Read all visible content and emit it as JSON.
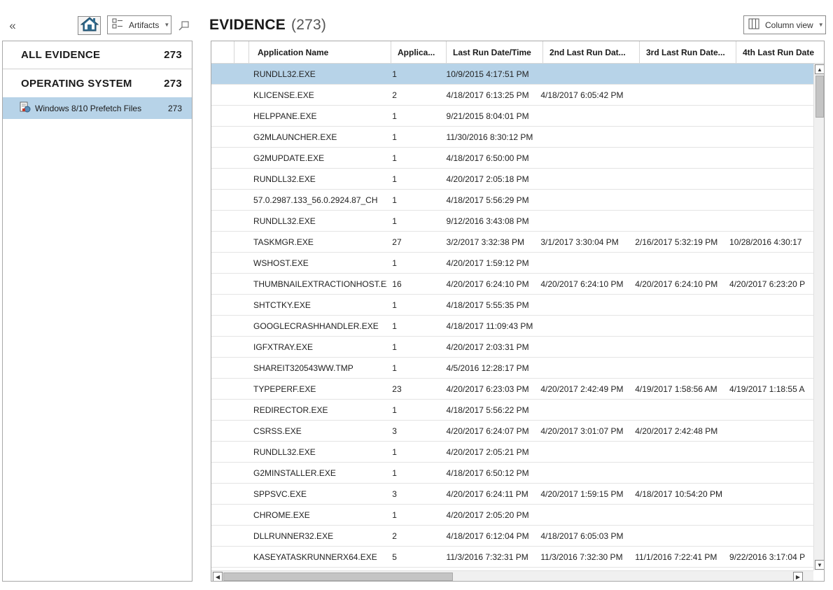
{
  "toolbar": {
    "collapse_glyph": "«",
    "home_icon": "home-icon",
    "artifacts_label": "Artifacts",
    "pin_icon": "pin-icon"
  },
  "categories": [
    {
      "label": "ALL EVIDENCE",
      "count": "273"
    },
    {
      "label": "OPERATING SYSTEM",
      "count": "273"
    }
  ],
  "subcategory": {
    "label": "Windows 8/10 Prefetch Files",
    "count": "273",
    "icon": "prefetch-file-icon"
  },
  "header": {
    "title": "EVIDENCE",
    "count": "(273)",
    "column_view_label": "Column view"
  },
  "colors": {
    "selection": "#b7d3e8",
    "border": "#a8a8a8"
  },
  "grid": {
    "columns": [
      "",
      "",
      "Application Name",
      "Applica...",
      "Last Run Date/Time",
      "2nd Last Run Dat...",
      "3rd Last Run Date...",
      "4th Last Run Date"
    ],
    "rows": [
      [
        "RUNDLL32.EXE",
        "1",
        "10/9/2015 4:17:51 PM",
        "",
        "",
        ""
      ],
      [
        "KLICENSE.EXE",
        "2",
        "4/18/2017 6:13:25 PM",
        "4/18/2017 6:05:42 PM",
        "",
        ""
      ],
      [
        "HELPPANE.EXE",
        "1",
        "9/21/2015 8:04:01 PM",
        "",
        "",
        ""
      ],
      [
        "G2MLAUNCHER.EXE",
        "1",
        "11/30/2016 8:30:12 PM",
        "",
        "",
        ""
      ],
      [
        "G2MUPDATE.EXE",
        "1",
        "4/18/2017 6:50:00 PM",
        "",
        "",
        ""
      ],
      [
        "RUNDLL32.EXE",
        "1",
        "4/20/2017 2:05:18 PM",
        "",
        "",
        ""
      ],
      [
        "57.0.2987.133_56.0.2924.87_CH",
        "1",
        "4/18/2017 5:56:29 PM",
        "",
        "",
        ""
      ],
      [
        "RUNDLL32.EXE",
        "1",
        "9/12/2016 3:43:08 PM",
        "",
        "",
        ""
      ],
      [
        "TASKMGR.EXE",
        "27",
        "3/2/2017 3:32:38 PM",
        "3/1/2017 3:30:04 PM",
        "2/16/2017 5:32:19 PM",
        "10/28/2016 4:30:17"
      ],
      [
        "WSHOST.EXE",
        "1",
        "4/20/2017 1:59:12 PM",
        "",
        "",
        ""
      ],
      [
        "THUMBNAILEXTRACTIONHOST.EXE",
        "16",
        "4/20/2017 6:24:10 PM",
        "4/20/2017 6:24:10 PM",
        "4/20/2017 6:24:10 PM",
        "4/20/2017 6:23:20 P"
      ],
      [
        "SHTCTKY.EXE",
        "1",
        "4/18/2017 5:55:35 PM",
        "",
        "",
        ""
      ],
      [
        "GOOGLECRASHHANDLER.EXE",
        "1",
        "4/18/2017 11:09:43 PM",
        "",
        "",
        ""
      ],
      [
        "IGFXTRAY.EXE",
        "1",
        "4/20/2017 2:03:31 PM",
        "",
        "",
        ""
      ],
      [
        "SHAREIT320543WW.TMP",
        "1",
        "4/5/2016 12:28:17 PM",
        "",
        "",
        ""
      ],
      [
        "TYPEPERF.EXE",
        "23",
        "4/20/2017 6:23:03 PM",
        "4/20/2017 2:42:49 PM",
        "4/19/2017 1:58:56 AM",
        "4/19/2017 1:18:55 A"
      ],
      [
        "REDIRECTOR.EXE",
        "1",
        "4/18/2017 5:56:22 PM",
        "",
        "",
        ""
      ],
      [
        "CSRSS.EXE",
        "3",
        "4/20/2017 6:24:07 PM",
        "4/20/2017 3:01:07 PM",
        "4/20/2017 2:42:48 PM",
        ""
      ],
      [
        "RUNDLL32.EXE",
        "1",
        "4/20/2017 2:05:21 PM",
        "",
        "",
        ""
      ],
      [
        "G2MINSTALLER.EXE",
        "1",
        "4/18/2017 6:50:12 PM",
        "",
        "",
        ""
      ],
      [
        "SPPSVC.EXE",
        "3",
        "4/20/2017 6:24:11 PM",
        "4/20/2017 1:59:15 PM",
        "4/18/2017 10:54:20 PM",
        ""
      ],
      [
        "CHROME.EXE",
        "1",
        "4/20/2017 2:05:20 PM",
        "",
        "",
        ""
      ],
      [
        "DLLRUNNER32.EXE",
        "2",
        "4/18/2017 6:12:04 PM",
        "4/18/2017 6:05:03 PM",
        "",
        ""
      ],
      [
        "KASEYATASKRUNNERX64.EXE",
        "5",
        "11/3/2016 7:32:31 PM",
        "11/3/2016 7:32:30 PM",
        "11/1/2016 7:22:41 PM",
        "9/22/2016 3:17:04 P"
      ]
    ],
    "selected_row": 0
  }
}
